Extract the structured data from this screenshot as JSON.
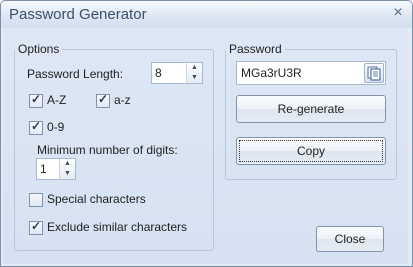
{
  "window": {
    "title": "Password Generator",
    "close_glyph": "×"
  },
  "options": {
    "group_label": "Options",
    "length_label": "Password Length:",
    "length_value": "8",
    "upper": {
      "label": "A-Z",
      "checked": true
    },
    "lower": {
      "label": "a-z",
      "checked": true
    },
    "digits": {
      "label": "0-9",
      "checked": true
    },
    "min_digits_label": "Minimum number of digits:",
    "min_digits_value": "1",
    "special": {
      "label": "Special characters",
      "checked": false
    },
    "exclude_similar": {
      "label": "Exclude similar characters",
      "checked": true
    }
  },
  "password": {
    "group_label": "Password",
    "value": "MGa3rU3R",
    "copy_icon": "clipboard-icon",
    "regenerate_label": "Re-generate",
    "copy_label": "Copy"
  },
  "footer": {
    "close_label": "Close"
  },
  "colors": {
    "titlebar": "#dde7f4",
    "client": "#d6e2f2",
    "border": "#7b8ea8"
  }
}
